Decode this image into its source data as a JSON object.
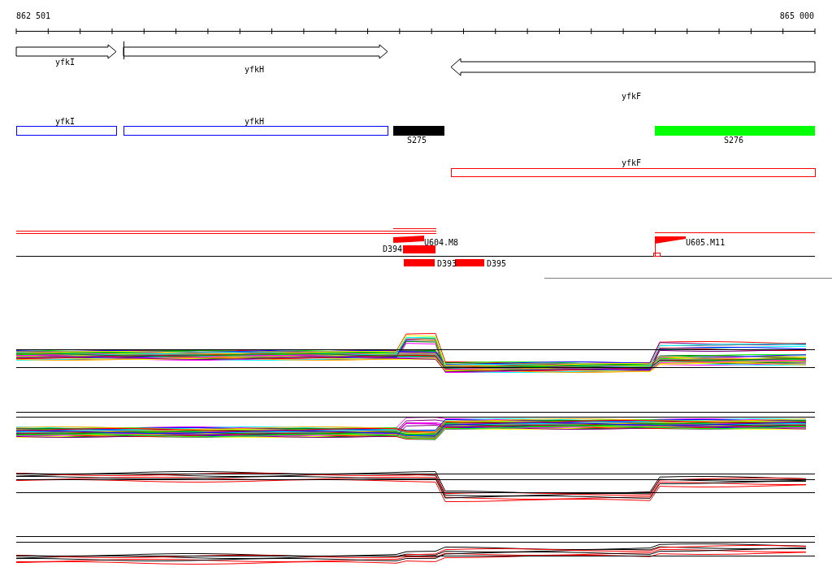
{
  "ruler": {
    "start_label": "862 501",
    "end_label": "865 000"
  },
  "genes": [
    {
      "label": "yfkI",
      "kind": "forward"
    },
    {
      "label": "yfkH",
      "kind": "forward"
    },
    {
      "label": "yfkF",
      "kind": "reverse"
    }
  ],
  "annotations": [
    {
      "label": "yfkI",
      "color": "#0000ff"
    },
    {
      "label": "yfkH",
      "color": "#0000ff"
    }
  ],
  "segments": [
    {
      "label": "S275",
      "color": "#000000"
    },
    {
      "label": "S276",
      "color": "#00ff00"
    }
  ],
  "transcripts": [
    {
      "label": "yfkF",
      "color": "#ff0000"
    }
  ],
  "features": [
    {
      "label": "D394"
    },
    {
      "label": "U604.M8"
    },
    {
      "label": "U605.M11"
    },
    {
      "label": "D393"
    },
    {
      "label": "D395"
    }
  ]
}
